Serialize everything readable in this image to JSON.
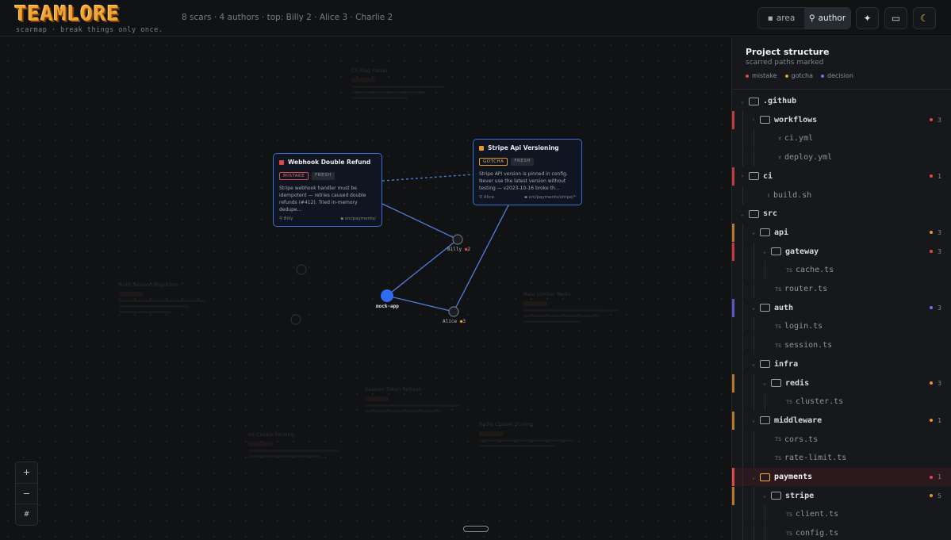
{
  "header": {
    "logo": "TEAMLORE",
    "tagline": "scarmap · break things only once.",
    "stats": "8 scars · 4 authors · top: Billy 2 · Alice 3 · Charlie 2",
    "view_toggle": [
      {
        "label": "area",
        "icon": "comment-icon",
        "active": false
      },
      {
        "label": "author",
        "icon": "person-icon",
        "active": true
      }
    ],
    "actions": [
      {
        "icon": "sparkle-icon",
        "glyph": "✦"
      },
      {
        "icon": "screen-icon",
        "glyph": "▭"
      },
      {
        "icon": "moon-icon",
        "glyph": "☾"
      }
    ]
  },
  "canvas": {
    "cards": [
      {
        "id": "webhook",
        "title": "Webhook Double Refund",
        "dot_color": "#e04848",
        "badges": [
          "MISTAKE",
          "FRESH"
        ],
        "body": "Stripe webhook handler must be idempotent — retries caused double refunds (#412). Tried in-memory dedupe...",
        "author": "Billy",
        "path": "src/payments/"
      },
      {
        "id": "stripe",
        "title": "Stripe Api Versioning",
        "dot_color": "#e8982b",
        "badges": [
          "GOTCHA",
          "FRESH"
        ],
        "body": "Stripe API version is pinned in config. Never use the latest version without testing — v2023-10-16 broke th...",
        "author": "Alice",
        "path": "src/payments/stripe/*"
      }
    ],
    "nodes": {
      "center": "mock-app",
      "billy": {
        "label": "Billy",
        "count": "2"
      },
      "alice": {
        "label": "Alice",
        "count": "3"
      }
    },
    "ghosts": [
      "Cli Flag Parser",
      "Auth Session Migration",
      "Rate Limiter Redis",
      "Session Token Refresh",
      "Ini Cookie Parsing",
      "Redis Cluster Scaling"
    ],
    "zoom": [
      "+",
      "−",
      "#"
    ]
  },
  "sidebar": {
    "title": "Project structure",
    "subtitle": "scarred paths marked",
    "legend": [
      {
        "label": "mistake",
        "color": "#e04848"
      },
      {
        "label": "gotcha",
        "color": "#e8982b"
      },
      {
        "label": "decision",
        "color": "#7a6cf0"
      }
    ],
    "tree": [
      {
        "name": ".github",
        "type": "dir",
        "depth": 0,
        "chev": "⌄",
        "mark": "",
        "count": ""
      },
      {
        "name": "workflows",
        "type": "dir",
        "depth": 1,
        "chev": "",
        "mark": "#c23a3a",
        "count": "3",
        "count_color": "#e04848"
      },
      {
        "name": "ci.yml",
        "type": "file",
        "depth": 2,
        "ext": "Y",
        "mark": "",
        "count": ""
      },
      {
        "name": "deploy.yml",
        "type": "file",
        "depth": 2,
        "ext": "Y",
        "mark": "",
        "count": ""
      },
      {
        "name": "ci",
        "type": "dir",
        "depth": 0,
        "chev": "",
        "mark": "#c23a3a",
        "count": "1",
        "count_color": "#e04848"
      },
      {
        "name": "build.sh",
        "type": "file",
        "depth": 1,
        "ext": "▯",
        "mark": "",
        "count": ""
      },
      {
        "name": "src",
        "type": "dir",
        "depth": 0,
        "chev": "⌄",
        "mark": "",
        "count": ""
      },
      {
        "name": "api",
        "type": "dir",
        "depth": 1,
        "chev": "⌄",
        "mark": "#b57a26",
        "count": "3",
        "count_color": "#e8982b"
      },
      {
        "name": "gateway",
        "type": "dir",
        "depth": 2,
        "chev": "⌄",
        "mark": "#c23a3a",
        "count": "3",
        "count_color": "#e04848"
      },
      {
        "name": "cache.ts",
        "type": "file",
        "depth": 3,
        "ext": "TS",
        "mark": "",
        "count": ""
      },
      {
        "name": "router.ts",
        "type": "file",
        "depth": 2,
        "ext": "TS",
        "mark": "",
        "count": ""
      },
      {
        "name": "auth",
        "type": "dir",
        "depth": 1,
        "chev": "⌄",
        "mark": "#5656c8",
        "count": "3",
        "count_color": "#7a6cf0"
      },
      {
        "name": "login.ts",
        "type": "file",
        "depth": 2,
        "ext": "TS",
        "mark": "",
        "count": ""
      },
      {
        "name": "session.ts",
        "type": "file",
        "depth": 2,
        "ext": "TS",
        "mark": "",
        "count": ""
      },
      {
        "name": "infra",
        "type": "dir",
        "depth": 1,
        "chev": "⌄",
        "mark": "",
        "count": ""
      },
      {
        "name": "redis",
        "type": "dir",
        "depth": 2,
        "chev": "⌄",
        "mark": "#b57a26",
        "count": "3",
        "count_color": "#e8982b"
      },
      {
        "name": "cluster.ts",
        "type": "file",
        "depth": 3,
        "ext": "TS",
        "mark": "",
        "count": ""
      },
      {
        "name": "middleware",
        "type": "dir",
        "depth": 1,
        "chev": "⌄",
        "mark": "#b57a26",
        "count": "1",
        "count_color": "#e8982b"
      },
      {
        "name": "cors.ts",
        "type": "file",
        "depth": 2,
        "ext": "TS",
        "mark": "",
        "count": ""
      },
      {
        "name": "rate-limit.ts",
        "type": "file",
        "depth": 2,
        "ext": "TS",
        "mark": "",
        "count": ""
      },
      {
        "name": "payments",
        "type": "dir",
        "depth": 1,
        "chev": "⌄",
        "mark": "#e04848",
        "count": "1",
        "count_color": "#e04848",
        "active": true
      },
      {
        "name": "stripe",
        "type": "dir",
        "depth": 2,
        "chev": "⌄",
        "mark": "#b57a26",
        "count": "5",
        "count_color": "#e8982b"
      },
      {
        "name": "client.ts",
        "type": "file",
        "depth": 3,
        "ext": "TS",
        "mark": "",
        "count": ""
      },
      {
        "name": "config.ts",
        "type": "file",
        "depth": 3,
        "ext": "TS",
        "mark": "",
        "count": ""
      }
    ]
  }
}
